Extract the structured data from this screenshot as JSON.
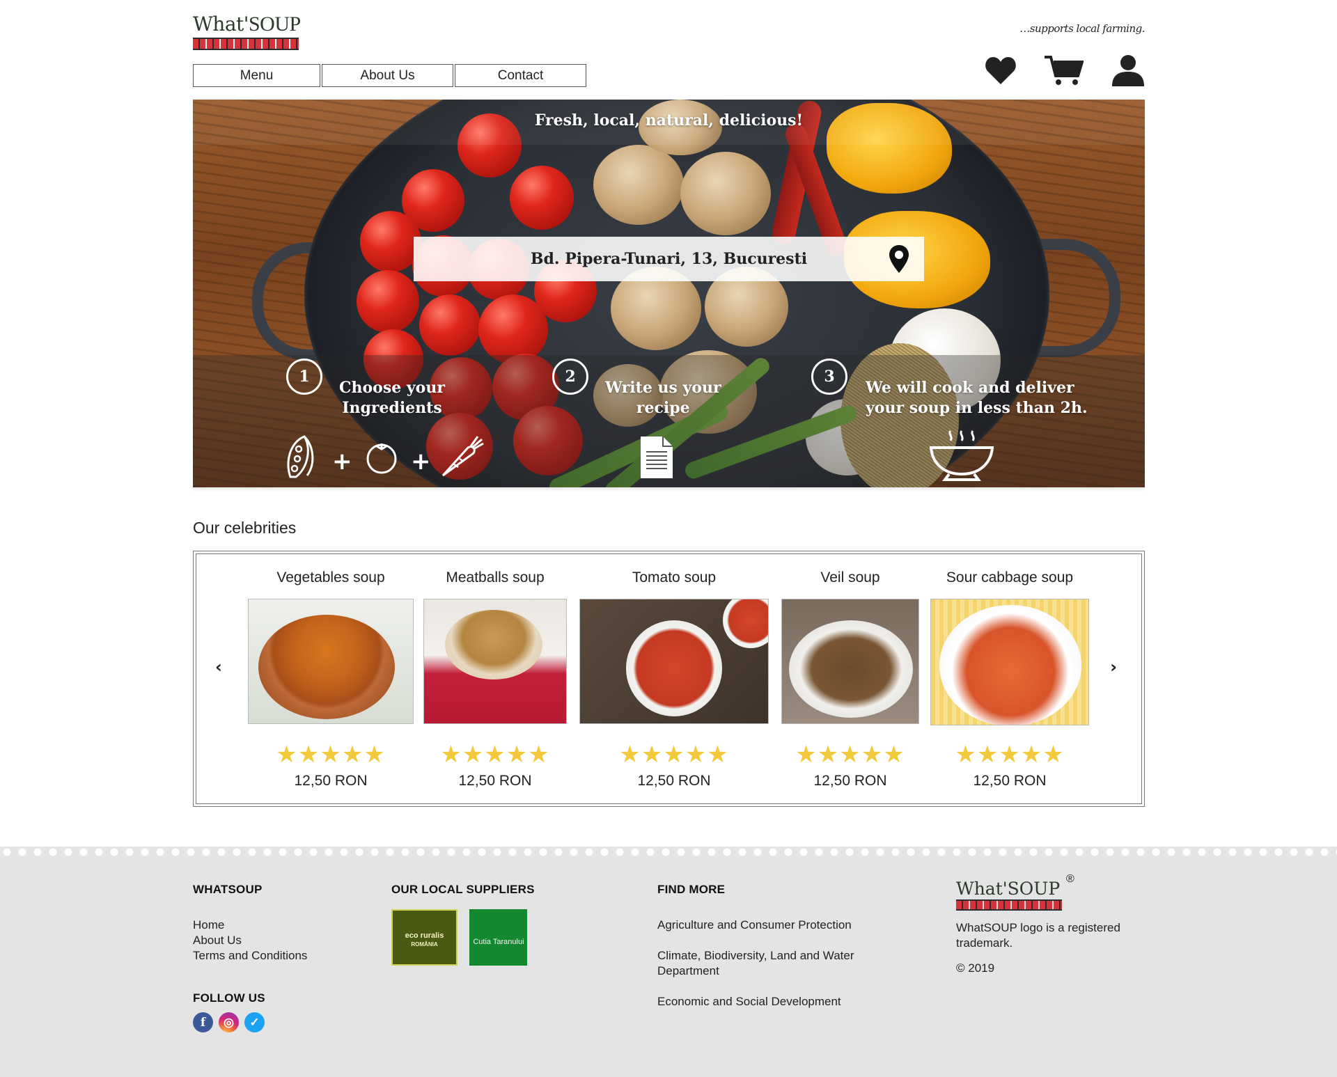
{
  "brand": {
    "logo_text_left": "What",
    "logo_text_right": "SOUP",
    "tagline": "…supports local farming.",
    "accent_red": "#d6333a",
    "star_color": "#f1c93b"
  },
  "nav": {
    "items": [
      "Menu",
      "About Us",
      "Contact"
    ]
  },
  "header_icons": [
    "heart-icon",
    "cart-icon",
    "user-icon"
  ],
  "hero": {
    "title": "Fresh, local, natural, delicious!",
    "address": "Bd. Pipera-Tunari, 13, Bucuresti",
    "steps": [
      {
        "number": "1",
        "line1": "Choose your",
        "line2": "Ingredients"
      },
      {
        "number": "2",
        "line1": "Write us your",
        "line2": "recipe"
      },
      {
        "number": "3",
        "line1": "We will cook and deliver",
        "line2": "your soup in less than 2h."
      }
    ],
    "plus": "+"
  },
  "celebrities": {
    "title": "Our celebrities",
    "prev": "‹",
    "next": "›",
    "items": [
      {
        "name": "Vegetables soup",
        "stars": "★★★★★",
        "price": "12,50 RON"
      },
      {
        "name": "Meatballs soup",
        "stars": "★★★★★",
        "price": "12,50 RON"
      },
      {
        "name": "Tomato soup",
        "stars": "★★★★★",
        "price": "12,50 RON"
      },
      {
        "name": "Veil soup",
        "stars": "★★★★★",
        "price": "12,50 RON"
      },
      {
        "name": "Sour cabbage soup",
        "stars": "★★★★★",
        "price": "12,50 RON"
      }
    ]
  },
  "footer": {
    "whatsoup": {
      "heading": "WHATSOUP",
      "links": [
        "Home",
        "About Us",
        "Terms and Conditions"
      ]
    },
    "follow": {
      "heading": "FOLLOW US",
      "fb": "f",
      "ig": "◎",
      "tw": "✓"
    },
    "suppliers": {
      "heading": "OUR LOCAL SUPPLIERS",
      "items": [
        "eco ruralis",
        "Cutia Taranului"
      ],
      "sub": [
        "ROMÂNIA"
      ]
    },
    "find_more": {
      "heading": "FIND MORE",
      "links": [
        "Agriculture and Consumer Protection",
        "Climate, Biodiversity, Land and Water Department",
        "Economic and Social Development"
      ]
    },
    "trademark": {
      "registered": "®",
      "text": "WhatSOUP logo is a registered trademark.",
      "copyright": "© 2019"
    }
  }
}
